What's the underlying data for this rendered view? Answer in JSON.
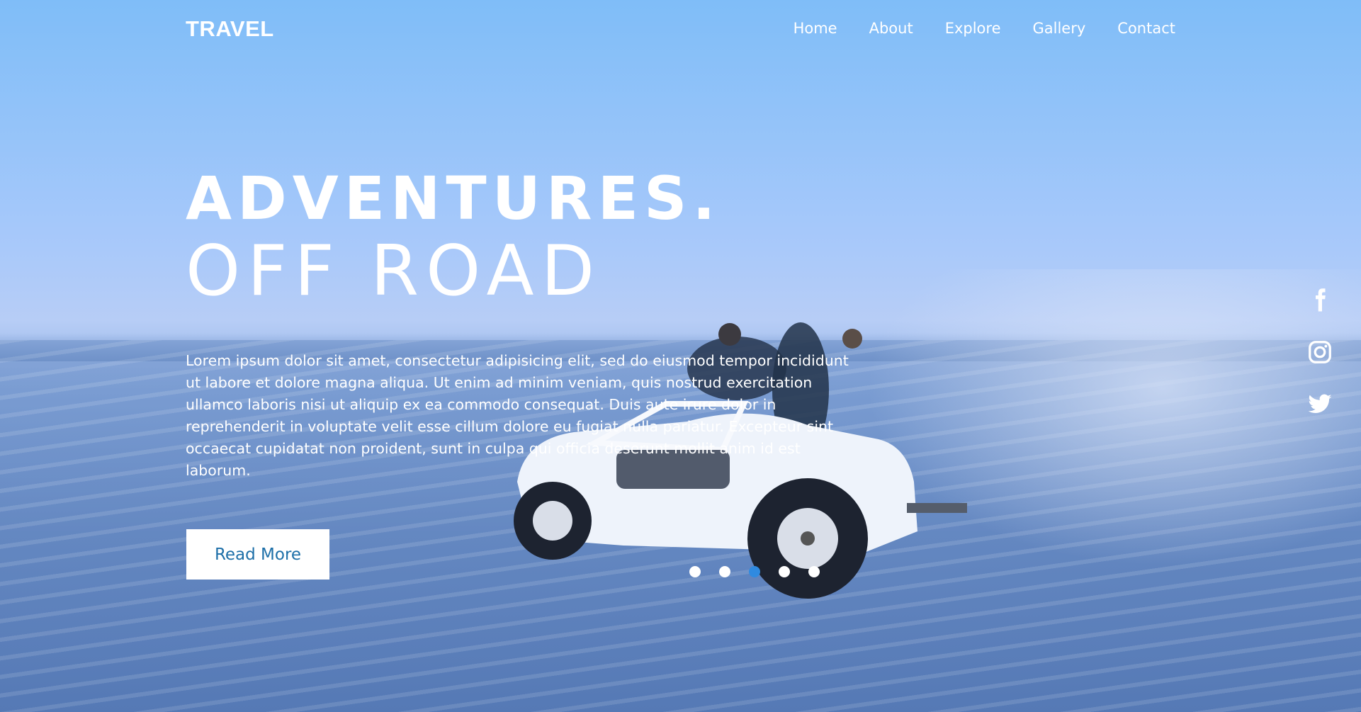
{
  "header": {
    "logo": "TRAVEL",
    "nav": [
      "Home",
      "About",
      "Explore",
      "Gallery",
      "Contact"
    ]
  },
  "hero": {
    "title_line1": "ADVENTURES.",
    "title_line2": "OFF ROAD",
    "description": "Lorem ipsum dolor sit amet, consectetur adipisicing elit, sed do eiusmod tempor incididunt ut labore et dolore magna aliqua. Ut enim ad minim veniam, quis nostrud exercitation ullamco laboris nisi ut aliquip ex ea commodo consequat. Duis aute irure dolor in reprehenderit in voluptate velit esse cillum dolore eu fugiat nulla pariatur. Excepteur sint occaecat cupidatat non proident, sunt in culpa qui officia deserunt mollit anim id est laborum.",
    "button_label": "Read More"
  },
  "slider": {
    "total": 5,
    "active_index": 2
  },
  "social": {
    "icons": [
      "facebook-icon",
      "instagram-icon",
      "twitter-icon"
    ]
  },
  "colors": {
    "accent": "#2f8ae0",
    "button_text": "#1d6fa8",
    "overlay": "#7fbdf8"
  }
}
